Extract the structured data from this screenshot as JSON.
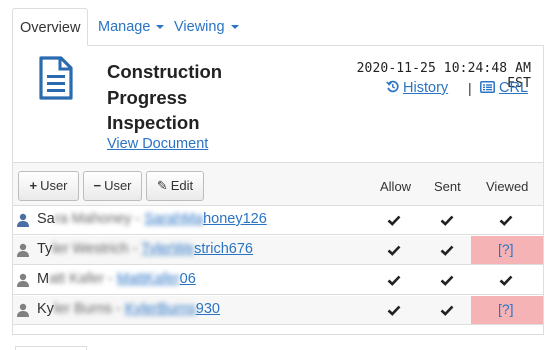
{
  "tabs": [
    {
      "label": "Overview",
      "active": true
    },
    {
      "label": "Manage",
      "dropdown": true
    },
    {
      "label": "Viewing",
      "dropdown": true
    }
  ],
  "document": {
    "title_lines": [
      "Construction",
      "Progress",
      "Inspection"
    ],
    "view_label": "View Document",
    "icon": "file-text-icon"
  },
  "header": {
    "timestamp": "2020-11-25 10:24:48 AM EST",
    "history_label": "History",
    "history_icon": "history-icon",
    "separator": "|",
    "crl_label": "CRL",
    "crl_icon": "list-card-icon"
  },
  "toolbar": {
    "add_user": {
      "symbol": "+",
      "label": "User"
    },
    "remove_user": {
      "symbol": "−",
      "label": "User"
    },
    "edit": {
      "symbol": "✎",
      "label": "Edit"
    }
  },
  "columns": {
    "allow": "Allow",
    "sent": "Sent",
    "viewed": "Viewed"
  },
  "users": [
    {
      "name_visible": "Sa",
      "name_blurred": "ra Mahoney",
      "dash": " - ",
      "link_blurred": "SarahMa",
      "link_visible": "honey126",
      "allow": true,
      "sent": true,
      "viewed": "check",
      "primary": true
    },
    {
      "name_visible": "Ty",
      "name_blurred": "ler Westrich",
      "dash": " - ",
      "link_blurred": "TylerWe",
      "link_visible": "strich676",
      "allow": true,
      "sent": true,
      "viewed": "[?]",
      "primary": false
    },
    {
      "name_visible": "M",
      "name_blurred": "att Kafer",
      "dash": " - ",
      "link_blurred": "MattKafer",
      "link_visible": "06",
      "allow": true,
      "sent": true,
      "viewed": "check",
      "primary": false
    },
    {
      "name_visible": "Ky",
      "name_blurred": "ler Burns",
      "dash": " - ",
      "link_blurred": "KylerBurns",
      "link_visible": "930",
      "allow": true,
      "sent": true,
      "viewed": "[?]",
      "primary": false
    }
  ],
  "colors": {
    "link": "#2a74c4",
    "alert": "#f6b3b6",
    "border": "#dddddd",
    "primary_user_icon": "#4a6fa5",
    "other_user_icon": "#808080"
  }
}
